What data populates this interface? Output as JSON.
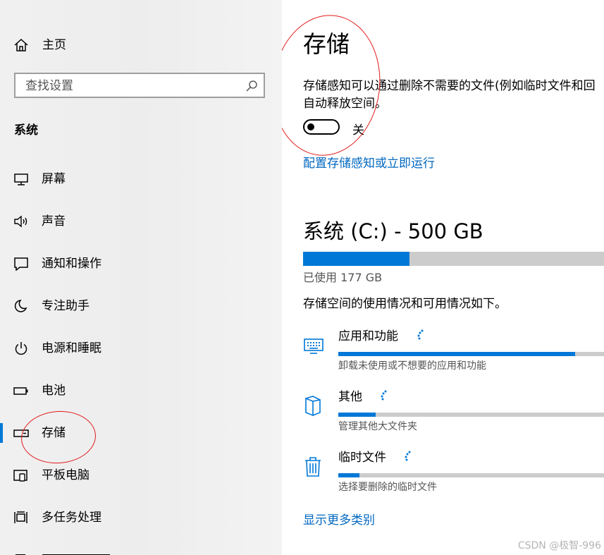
{
  "sidebar": {
    "home_label": "主页",
    "search": {
      "placeholder": "查找设置"
    },
    "section_title": "系统",
    "items": [
      {
        "label": "屏幕",
        "icon": "monitor-icon"
      },
      {
        "label": "声音",
        "icon": "speaker-icon"
      },
      {
        "label": "通知和操作",
        "icon": "notification-icon"
      },
      {
        "label": "专注助手",
        "icon": "moon-icon"
      },
      {
        "label": "电源和睡眠",
        "icon": "power-icon"
      },
      {
        "label": "电池",
        "icon": "battery-icon"
      },
      {
        "label": "存储",
        "icon": "storage-icon",
        "selected": true
      },
      {
        "label": "平板电脑",
        "icon": "tablet-icon"
      },
      {
        "label": "多任务处理",
        "icon": "multitask-icon"
      }
    ]
  },
  "main": {
    "title": "存储",
    "storage_sense": {
      "description_line1": "存储感知可以通过删除不需要的文件(例如临时文件和回",
      "description_line2": "自动释放空间。",
      "toggle_state": "关",
      "toggle_on": false,
      "configure_link": "配置存储感知或立即运行"
    },
    "drive": {
      "title": "系统 (C:) - 500 GB",
      "used_label": "已使用 177 GB",
      "used_fraction": 0.354
    },
    "usage_note": "存储空间的使用情况和可用情况如下。",
    "categories": [
      {
        "name": "应用和功能",
        "subtitle": "卸载未使用或不想要的应用和功能",
        "icon": "apps-keyboard-icon",
        "fraction": 0.89
      },
      {
        "name": "其他",
        "subtitle": "管理其他大文件夹",
        "icon": "other-folder-icon",
        "fraction": 0.14
      },
      {
        "name": "临时文件",
        "subtitle": "选择要删除的临时文件",
        "icon": "trash-icon",
        "fraction": 0.08
      }
    ],
    "show_more_link": "显示更多类别"
  },
  "watermark": "CSDN @极智-996",
  "colors": {
    "accent": "#0078d7",
    "link": "#0067c0",
    "bar_bg": "#cccccc",
    "annotation": "#e11c1c"
  }
}
